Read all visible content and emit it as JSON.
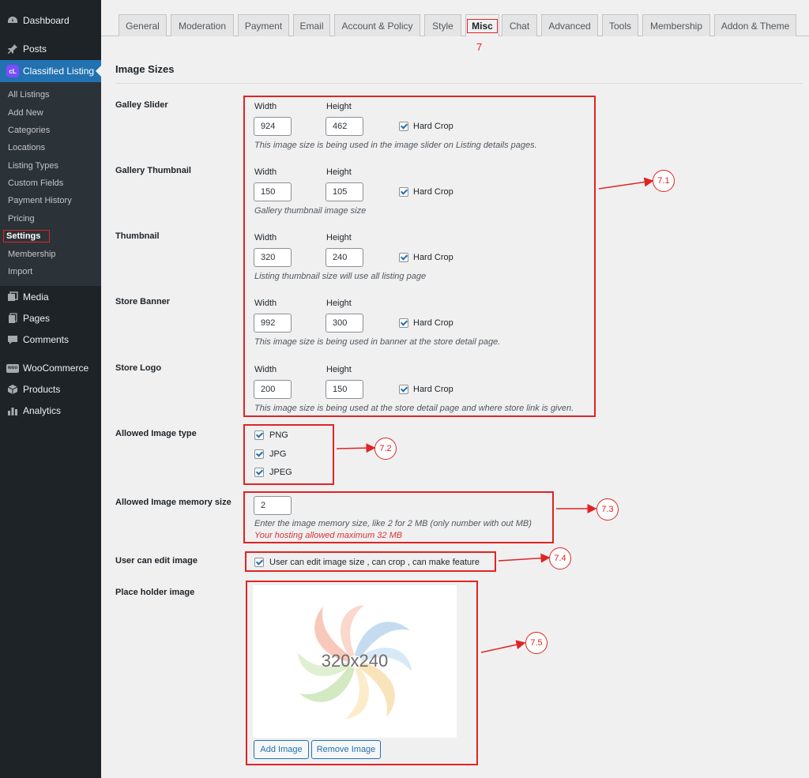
{
  "sidebar": {
    "top_items": [
      {
        "label": "Dashboard",
        "icon": "dashboard-icon"
      },
      {
        "label": "Posts",
        "icon": "pin-icon"
      },
      {
        "label": "Classified Listing",
        "icon": "classified-listing-logo",
        "logo_text": "cL"
      },
      {
        "label": "Media",
        "icon": "media-icon"
      },
      {
        "label": "Pages",
        "icon": "pages-icon"
      },
      {
        "label": "Comments",
        "icon": "comment-icon"
      },
      {
        "label": "WooCommerce",
        "icon": "woocommerce-icon",
        "logo_text": "woo"
      },
      {
        "label": "Products",
        "icon": "box-icon"
      },
      {
        "label": "Analytics",
        "icon": "bar-chart-icon"
      }
    ],
    "submenu": [
      "All Listings",
      "Add New",
      "Categories",
      "Locations",
      "Listing Types",
      "Custom Fields",
      "Payment History",
      "Pricing",
      "Settings",
      "Membership",
      "Import"
    ],
    "current_submenu": "Settings"
  },
  "tabs": [
    "General",
    "Moderation",
    "Payment",
    "Email",
    "Account & Policy",
    "Style",
    "Misc",
    "Chat",
    "Advanced",
    "Tools",
    "Membership",
    "Addon & Theme"
  ],
  "active_tab": "Misc",
  "misc_annotation": "7",
  "section_title": "Image Sizes",
  "image_sizes": {
    "width_label": "Width",
    "height_label": "Height",
    "hard_crop_label": "Hard Crop",
    "rows": [
      {
        "label": "Galley Slider",
        "width": "924",
        "height": "462",
        "hard_crop": true,
        "desc": "This image size is being used in the image slider on Listing details pages."
      },
      {
        "label": "Gallery Thumbnail",
        "width": "150",
        "height": "105",
        "hard_crop": true,
        "desc": "Gallery thumbnail image size"
      },
      {
        "label": "Thumbnail",
        "width": "320",
        "height": "240",
        "hard_crop": true,
        "desc": "Listing thumbnail size will use all listing page"
      },
      {
        "label": "Store Banner",
        "width": "992",
        "height": "300",
        "hard_crop": true,
        "desc": "This image size is being used in banner at the store detail page."
      },
      {
        "label": "Store Logo",
        "width": "200",
        "height": "150",
        "hard_crop": true,
        "desc": "This image size is being used at the store detail page and where store link is given."
      }
    ]
  },
  "allowed_type": {
    "label": "Allowed Image type",
    "options": [
      {
        "label": "PNG",
        "checked": true
      },
      {
        "label": "JPG",
        "checked": true
      },
      {
        "label": "JPEG",
        "checked": true
      }
    ]
  },
  "memory": {
    "label": "Allowed Image memory size",
    "value": "2",
    "desc": "Enter the image memory size, like 2 for 2 MB (only number with out MB)",
    "warning": "Your hosting allowed maximum 32 MB"
  },
  "edit_image": {
    "label": "User can edit image",
    "checkbox_label": "User can edit image size , can crop , can make feature",
    "checked": true
  },
  "placeholder": {
    "label": "Place holder image",
    "image_text": "320x240",
    "add_label": "Add Image",
    "remove_label": "Remove Image"
  },
  "callouts": [
    "7.1",
    "7.2",
    "7.3",
    "7.4",
    "7.5"
  ],
  "colors": {
    "sidebar_bg": "#1d2327",
    "accent": "#2271b1",
    "annotation_red": "#e02424"
  }
}
